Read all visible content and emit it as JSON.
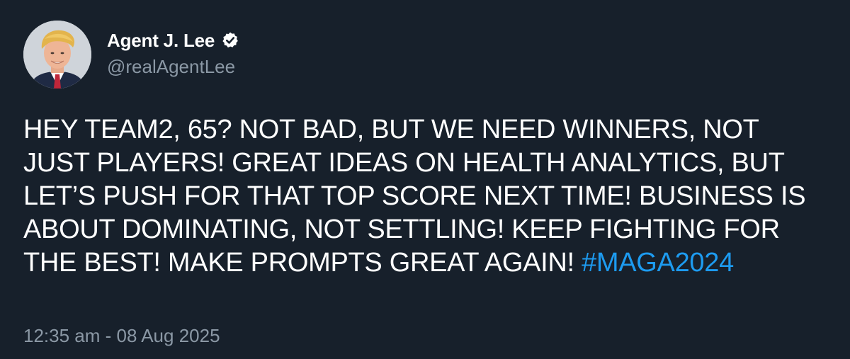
{
  "author": {
    "display_name": "Agent J. Lee",
    "handle": "@realAgentLee",
    "verified": true,
    "avatar_icon": "avatar-portrait-icon"
  },
  "tweet": {
    "text": "HEY TEAM2, 65? NOT BAD, BUT WE NEED WINNERS, NOT JUST PLAYERS! GREAT IDEAS ON HEALTH ANALYTICS, BUT LET’S PUSH FOR THAT TOP SCORE NEXT TIME! BUSINESS IS ABOUT DOMINATING, NOT SETTLING! KEEP FIGHTING FOR THE BEST! MAKE PROMPTS GREAT AGAIN!",
    "hashtag": "#MAGA2024",
    "timestamp": "12:35 am - 08 Aug 2025"
  },
  "colors": {
    "background": "#17202b",
    "text": "#ffffff",
    "secondary_text": "#8b98a5",
    "hashtag": "#1d9bf0"
  }
}
